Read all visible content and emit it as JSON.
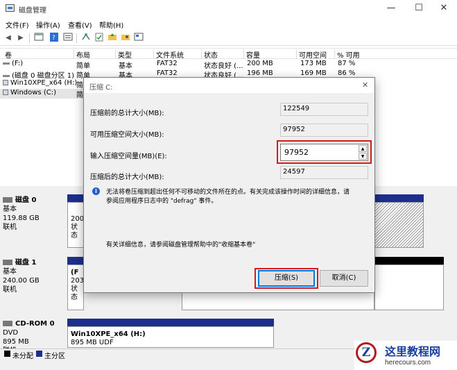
{
  "window": {
    "title": "磁盘管理",
    "minimize": "—",
    "maximize": "☐",
    "close": "✕"
  },
  "menu": [
    "文件(F)",
    "操作(A)",
    "查看(V)",
    "帮助(H)"
  ],
  "toolbar": {
    "back": "◀",
    "forward": "▶"
  },
  "table": {
    "headers": [
      "卷",
      "布局",
      "类型",
      "文件系统",
      "状态",
      "容量",
      "可用空间",
      "% 可用"
    ],
    "rows": [
      [
        "(F:)",
        "简单",
        "基本",
        "FAT32",
        "状态良好 (...",
        "200 MB",
        "173 MB",
        "87 %"
      ],
      [
        "(磁盘 0 磁盘分区 1)",
        "简单",
        "基本",
        "FAT32",
        "状态良好 (...",
        "196 MB",
        "169 MB",
        "86 %"
      ],
      [
        "Win10XPE_x64 (H:)",
        "简",
        "",
        "",
        "",
        "",
        "",
        ""
      ],
      [
        "Windows (C:)",
        "简",
        "",
        "",
        "",
        "",
        "",
        ""
      ]
    ]
  },
  "disks": [
    {
      "name": "磁盘 0",
      "type": "基本",
      "size": "119.88 GB",
      "status": "联机",
      "part_text": [
        "200",
        "状态"
      ]
    },
    {
      "name": "磁盘 1",
      "type": "基本",
      "size": "240.00 GB",
      "status": "联机",
      "part_label": "(F",
      "part_text": [
        "203",
        "状态"
      ]
    },
    {
      "name": "CD-ROM 0",
      "type": "DVD",
      "size": "895 MB",
      "status": "联机",
      "part_title": "Win10XPE_x64 (H:)",
      "part_fs": "895 MB UDF"
    }
  ],
  "legend": [
    "未分配",
    "主分区"
  ],
  "colors": {
    "unallocated": "#000000",
    "primary": "#1e2e8f",
    "highlight": "#d61a1a"
  },
  "dialog": {
    "title": "压缩 C:",
    "close": "✕",
    "fields": [
      {
        "label": "压缩前的总计大小(MB):",
        "value": "122549"
      },
      {
        "label": "可用压缩空间大小(MB):",
        "value": "97952"
      },
      {
        "label": "输入压缩空间量(MB)(E):",
        "value": "97952"
      },
      {
        "label": "压缩后的总计大小(MB):",
        "value": "24597"
      }
    ],
    "info_icon": "i",
    "info_line1": "无法将卷压缩到超出任何不可移动的文件所在的点。有关完成该操作时间的详细信息，请",
    "info_line2": "参阅应用程序日志中的 \"defrag\" 事件。",
    "help_text": "有关详细信息，请参阅磁盘管理帮助中的\"收缩基本卷\"",
    "shrink_button": "压缩(S)",
    "cancel_button": "取消(C)"
  },
  "watermark": {
    "brand": "这里教程网",
    "site": "herecours.com",
    "logo": "Z"
  }
}
